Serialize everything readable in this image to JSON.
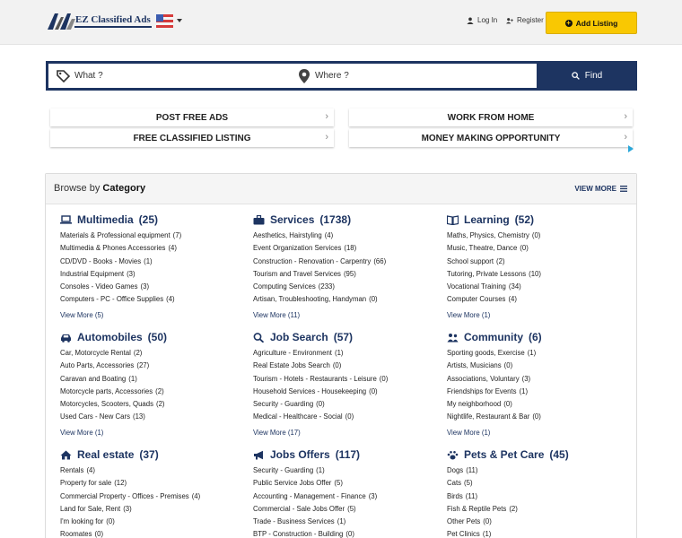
{
  "header": {
    "logo_text": "EZ Classified Ads",
    "login_label": "Log In",
    "register_label": "Register",
    "add_listing_label": "Add Listing",
    "language": "English"
  },
  "search": {
    "what_placeholder": "What ?",
    "where_placeholder": "Where ?",
    "find_label": "Find"
  },
  "ads": [
    "POST FREE ADS",
    "WORK FROM HOME",
    "FREE CLASSIFIED LISTING",
    "MONEY MAKING OPPORTUNITY"
  ],
  "browse": {
    "prefix": "Browse by",
    "title": "Category",
    "view_more": "VIEW MORE"
  },
  "categories": [
    {
      "name": "Multimedia",
      "count": "(25)",
      "icon": "laptop-icon",
      "items": [
        {
          "label": "Materials & Professional equipment",
          "count": "(7)"
        },
        {
          "label": "Multimedia & Phones Accessories",
          "count": "(4)"
        },
        {
          "label": "CD/DVD - Books - Movies",
          "count": "(1)"
        },
        {
          "label": "Industrial Equipment",
          "count": "(3)"
        },
        {
          "label": "Consoles - Video Games",
          "count": "(3)"
        },
        {
          "label": "Computers - PC - Office Supplies",
          "count": "(4)"
        }
      ],
      "more": "View More (5)"
    },
    {
      "name": "Services",
      "count": "(1738)",
      "icon": "briefcase-icon",
      "items": [
        {
          "label": "Aesthetics, Hairstyling",
          "count": "(4)"
        },
        {
          "label": "Event Organization Services",
          "count": "(18)"
        },
        {
          "label": "Construction - Renovation - Carpentry",
          "count": "(66)"
        },
        {
          "label": "Tourism and Travel Services",
          "count": "(95)"
        },
        {
          "label": "Computing Services",
          "count": "(233)"
        },
        {
          "label": "Artisan, Troubleshooting, Handyman",
          "count": "(0)"
        }
      ],
      "more": "View More (11)"
    },
    {
      "name": "Learning",
      "count": "(52)",
      "icon": "book-icon",
      "items": [
        {
          "label": "Maths, Physics, Chemistry",
          "count": "(0)"
        },
        {
          "label": "Music, Theatre, Dance",
          "count": "(0)"
        },
        {
          "label": "School support",
          "count": "(2)"
        },
        {
          "label": "Tutoring, Private Lessons",
          "count": "(10)"
        },
        {
          "label": "Vocational Training",
          "count": "(34)"
        },
        {
          "label": "Computer Courses",
          "count": "(4)"
        }
      ],
      "more": "View More (1)"
    },
    {
      "name": "Automobiles",
      "count": "(50)",
      "icon": "car-icon",
      "items": [
        {
          "label": "Car, Motorcycle Rental",
          "count": "(2)"
        },
        {
          "label": "Auto Parts, Accessories",
          "count": "(27)"
        },
        {
          "label": "Caravan and Boating",
          "count": "(1)"
        },
        {
          "label": "Motorcycle parts, Accessories",
          "count": "(2)"
        },
        {
          "label": "Motorcycles, Scooters, Quads",
          "count": "(2)"
        },
        {
          "label": "Used Cars - New Cars",
          "count": "(13)"
        }
      ],
      "more": "View More (1)"
    },
    {
      "name": "Job Search",
      "count": "(57)",
      "icon": "magnifier-icon",
      "items": [
        {
          "label": "Agriculture - Environment",
          "count": "(1)"
        },
        {
          "label": "Real Estate Jobs Search",
          "count": "(0)"
        },
        {
          "label": "Tourism - Hotels - Restaurants - Leisure",
          "count": "(0)"
        },
        {
          "label": "Household Services - Housekeeping",
          "count": "(0)"
        },
        {
          "label": "Security - Guarding",
          "count": "(0)"
        },
        {
          "label": "Medical - Healthcare - Social",
          "count": "(0)"
        }
      ],
      "more": "View More (17)"
    },
    {
      "name": "Community",
      "count": "(6)",
      "icon": "community-icon",
      "items": [
        {
          "label": "Sporting goods, Exercise",
          "count": "(1)"
        },
        {
          "label": "Artists, Musicians",
          "count": "(0)"
        },
        {
          "label": "Associations, Voluntary",
          "count": "(3)"
        },
        {
          "label": "Friendships for Events",
          "count": "(1)"
        },
        {
          "label": "My neighborhood",
          "count": "(0)"
        },
        {
          "label": "Nightlife, Restaurant & Bar",
          "count": "(0)"
        }
      ],
      "more": "View More (1)"
    },
    {
      "name": "Real estate",
      "count": "(37)",
      "icon": "home-icon",
      "items": [
        {
          "label": "Rentals",
          "count": "(4)"
        },
        {
          "label": "Property for sale",
          "count": "(12)"
        },
        {
          "label": "Commercial Property - Offices - Premises",
          "count": "(4)"
        },
        {
          "label": "Land for Sale, Rent",
          "count": "(3)"
        },
        {
          "label": "I'm looking for",
          "count": "(0)"
        },
        {
          "label": "Roomates",
          "count": "(0)"
        }
      ],
      "more": ""
    },
    {
      "name": "Jobs Offers",
      "count": "(117)",
      "icon": "megaphone-icon",
      "items": [
        {
          "label": "Security - Guarding",
          "count": "(1)"
        },
        {
          "label": "Public Service Jobs Offer",
          "count": "(5)"
        },
        {
          "label": "Accounting - Management - Finance",
          "count": "(3)"
        },
        {
          "label": "Commercial - Sale Jobs Offer",
          "count": "(5)"
        },
        {
          "label": "Trade - Business Services",
          "count": "(1)"
        },
        {
          "label": "BTP - Construction - Building",
          "count": "(0)"
        }
      ],
      "more": ""
    },
    {
      "name": "Pets & Pet Care",
      "count": "(45)",
      "icon": "paw-icon",
      "items": [
        {
          "label": "Dogs",
          "count": "(11)"
        },
        {
          "label": "Cats",
          "count": "(5)"
        },
        {
          "label": "Birds",
          "count": "(11)"
        },
        {
          "label": "Fish & Reptile Pets",
          "count": "(2)"
        },
        {
          "label": "Other Pets",
          "count": "(0)"
        },
        {
          "label": "Pet Clinics",
          "count": "(1)"
        }
      ],
      "more": ""
    }
  ]
}
